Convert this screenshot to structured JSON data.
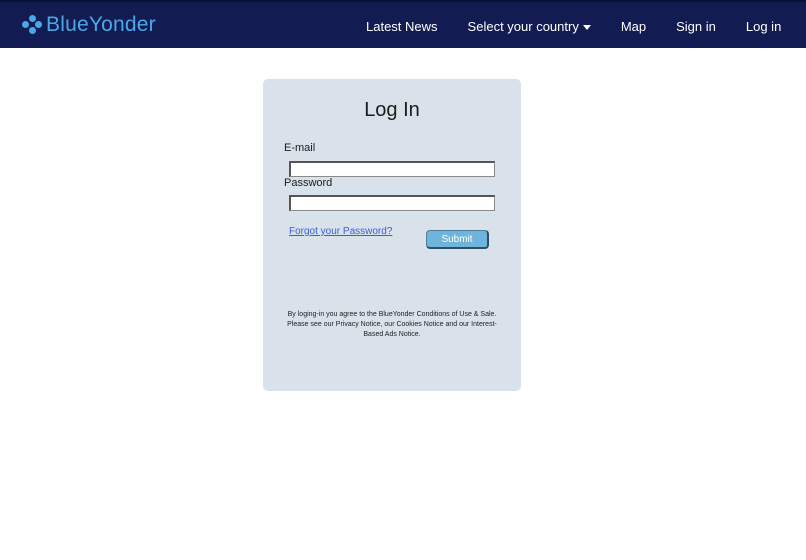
{
  "brand": {
    "name": "BlueYonder",
    "logo_icon": "four-dots-logo-icon",
    "color": "#4aa8e8"
  },
  "nav": {
    "latest_news": "Latest News",
    "select_country": "Select your country",
    "map": "Map",
    "sign_in": "Sign in",
    "log_in": "Log in",
    "background": "#131c52"
  },
  "login": {
    "title": "Log In",
    "email_label": "E-mail",
    "email_value": "",
    "password_label": "Password",
    "password_value": "",
    "forgot_link": "Forgot your Password?",
    "submit_label": "Submit",
    "legal_text": "By loging-in you agree to the BlueYonder Conditions of Use & Sale. Please see our Privacy Notice, our Cookies Notice and our Interest-Based Ads Notice.",
    "card_background": "#d9e2ea"
  }
}
